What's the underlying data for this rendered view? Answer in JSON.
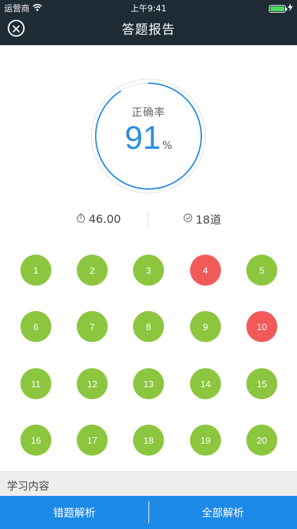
{
  "status_bar": {
    "carrier": "运营商",
    "time": "上午9:41"
  },
  "nav": {
    "title": "答题报告"
  },
  "score": {
    "label": "正确率",
    "value": "91",
    "unit": "%",
    "progress_fraction": 0.91
  },
  "stats": {
    "time": "46.00",
    "count": "18道"
  },
  "questions": [
    {
      "n": "1",
      "status": "correct"
    },
    {
      "n": "2",
      "status": "correct"
    },
    {
      "n": "3",
      "status": "correct"
    },
    {
      "n": "4",
      "status": "wrong"
    },
    {
      "n": "5",
      "status": "correct"
    },
    {
      "n": "6",
      "status": "correct"
    },
    {
      "n": "7",
      "status": "correct"
    },
    {
      "n": "8",
      "status": "correct"
    },
    {
      "n": "9",
      "status": "correct"
    },
    {
      "n": "10",
      "status": "wrong"
    },
    {
      "n": "11",
      "status": "correct"
    },
    {
      "n": "12",
      "status": "correct"
    },
    {
      "n": "13",
      "status": "correct"
    },
    {
      "n": "14",
      "status": "correct"
    },
    {
      "n": "15",
      "status": "correct"
    },
    {
      "n": "16",
      "status": "correct"
    },
    {
      "n": "17",
      "status": "correct"
    },
    {
      "n": "18",
      "status": "correct"
    },
    {
      "n": "19",
      "status": "correct"
    },
    {
      "n": "20",
      "status": "correct"
    }
  ],
  "study": {
    "title": "学习内容"
  },
  "bottom": {
    "wrong_analysis": "错题解析",
    "all_analysis": "全部解析"
  },
  "icons": {
    "close": "close-icon",
    "timer": "stopwatch-icon",
    "count": "clock-check-icon",
    "wifi": "wifi-icon",
    "battery": "battery-icon",
    "charging": "charging-bolt-icon"
  },
  "colors": {
    "header": "#1f2c36",
    "accent": "#2b8fe0",
    "correct": "#8cc63f",
    "wrong": "#f25a5a",
    "bottom_bar": "#1e8ae8"
  }
}
